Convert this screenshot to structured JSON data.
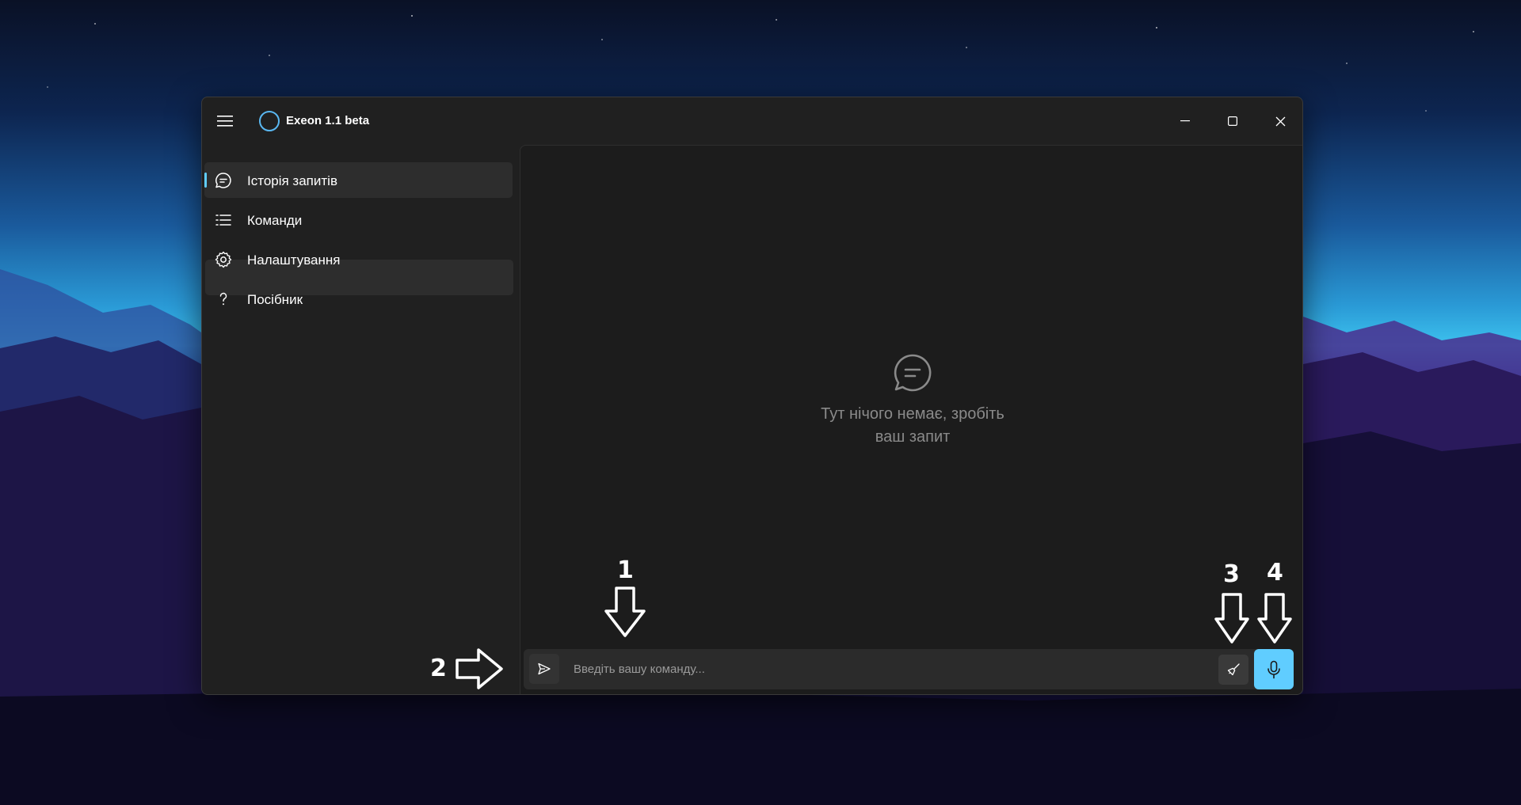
{
  "app": {
    "title": "Exeon 1.1 beta"
  },
  "sidebar": {
    "items": [
      {
        "label": "Історія запитів",
        "icon": "chat-icon",
        "selected": true
      },
      {
        "label": "Команди",
        "icon": "list-icon",
        "selected": false
      },
      {
        "label": "Налаштування",
        "icon": "gear-icon",
        "selected": false
      },
      {
        "label": "Посібник",
        "icon": "question-icon",
        "selected": false
      }
    ]
  },
  "main": {
    "empty_state": {
      "icon": "chat-icon",
      "text": "Тут нічого немає, зробіть\nваш запит"
    }
  },
  "input_bar": {
    "placeholder": "Введіть вашу команду...",
    "value": "",
    "send_icon": "send-icon",
    "clear_icon": "broom-icon",
    "mic_icon": "microphone-icon"
  },
  "annotations": {
    "marker_1": "1",
    "marker_2": "2",
    "marker_3": "3",
    "marker_4": "4"
  },
  "colors": {
    "accent": "#60cdff",
    "logo": "#5ab8f2",
    "window_bg": "#202020",
    "content_bg": "#1c1c1c",
    "selected_bg": "#2d2d2d"
  }
}
